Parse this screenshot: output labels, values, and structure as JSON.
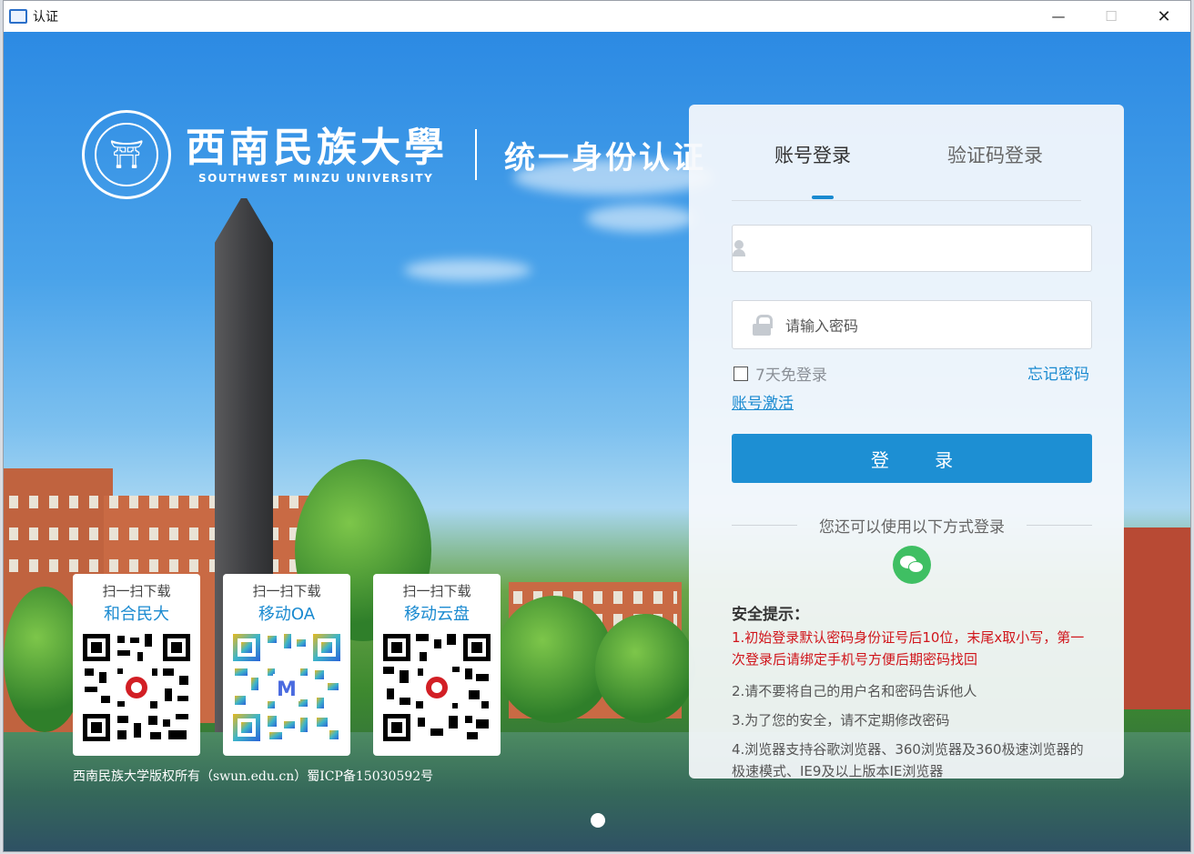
{
  "window": {
    "title": "认证",
    "minimize": "—",
    "maximize": "☐",
    "close": "✕"
  },
  "branding": {
    "university_cn": "西南民族大學",
    "university_en": "SOUTHWEST MINZU UNIVERSITY",
    "system_name": "统一身份认证"
  },
  "qr_cards": [
    {
      "top": "扫一扫下载",
      "name": "和合民大"
    },
    {
      "top": "扫一扫下载",
      "name": "移动OA"
    },
    {
      "top": "扫一扫下载",
      "name": "移动云盘"
    }
  ],
  "copyright": "西南民族大学版权所有（swun.edu.cn）蜀ICP备15030592号",
  "login": {
    "tabs": [
      "账号登录",
      "验证码登录"
    ],
    "username_value": "",
    "password_placeholder": "请输入密码",
    "remember": "7天免登录",
    "forgot": "忘记密码",
    "activate": "账号激活",
    "submit": "登 录",
    "alt_methods": "您还可以使用以下方式登录",
    "tips_title": "安全提示：",
    "tips": [
      "1.初始登录默认密码身份证号后10位，末尾x取小写，第一次登录后请绑定手机号方便后期密码找回",
      "2.请不要将自己的用户名和密码告诉他人",
      "3.为了您的安全，请不定期修改密码",
      "4.浏览器支持谷歌浏览器、360浏览器及360极速浏览器的极速模式、IE9及以上版本IE浏览器"
    ]
  },
  "colors": {
    "accent": "#1d8fd3",
    "warning": "#d0151b",
    "wechat": "#3fbf63"
  }
}
